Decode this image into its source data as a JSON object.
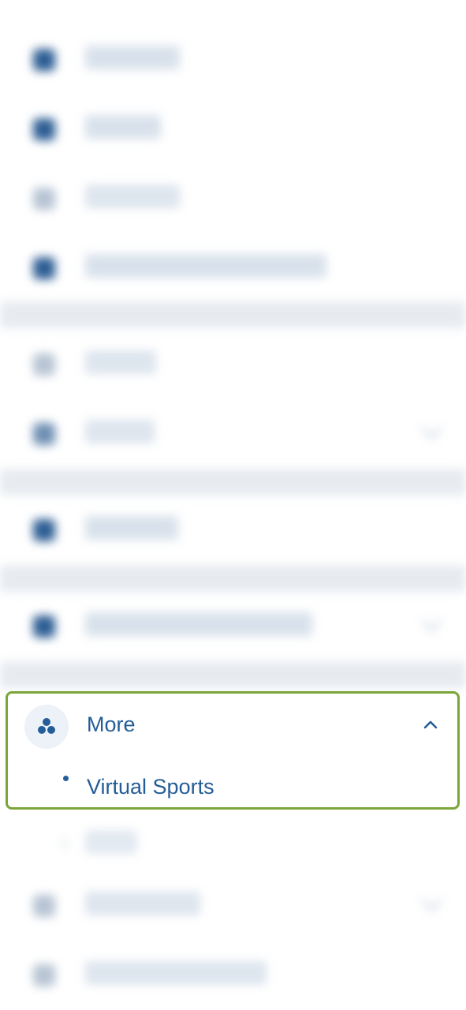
{
  "menu": {
    "more": {
      "label": "More",
      "expanded": true,
      "items": [
        {
          "label": "Virtual Sports"
        }
      ]
    }
  },
  "colors": {
    "accent": "#245d97",
    "highlight_border": "#7aa638"
  }
}
